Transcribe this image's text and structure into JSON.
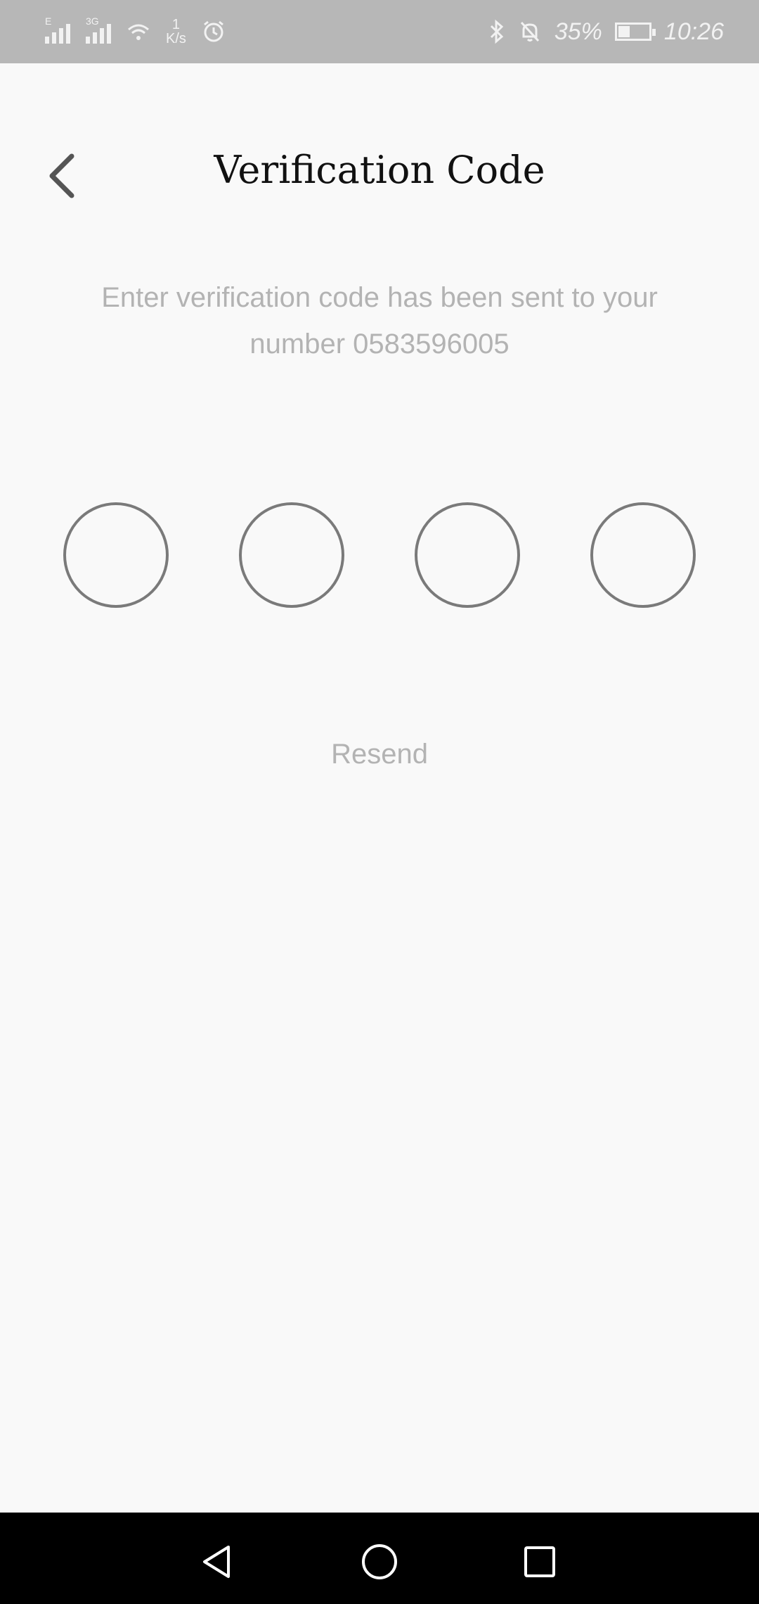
{
  "status_bar": {
    "signal1_label": "E",
    "signal2_label": "3G",
    "net_speed_value": "1",
    "net_speed_unit": "K/s",
    "battery_percent": "35%",
    "battery_level": 0.35,
    "time": "10:26",
    "icons": [
      "signal-icon",
      "signal-icon",
      "wifi-icon",
      "alarm-icon",
      "bluetooth-icon",
      "silent-bell-icon",
      "battery-icon"
    ]
  },
  "header": {
    "title": "Verification Code",
    "back_icon": "chevron-left-icon"
  },
  "main": {
    "instructions": "Enter verification code has been sent to your number 0583596005",
    "code_digits": [
      "",
      "",
      "",
      ""
    ],
    "resend_label": "Resend"
  },
  "nav": {
    "icons": [
      "back-triangle-icon",
      "home-circle-icon",
      "recents-square-icon"
    ]
  },
  "colors": {
    "status_bar": "#b7b7b7",
    "background": "#f9f9f9",
    "muted_text": "#b3b3b3",
    "circle_border": "#7a7a7a",
    "nav_bar": "#000000"
  }
}
